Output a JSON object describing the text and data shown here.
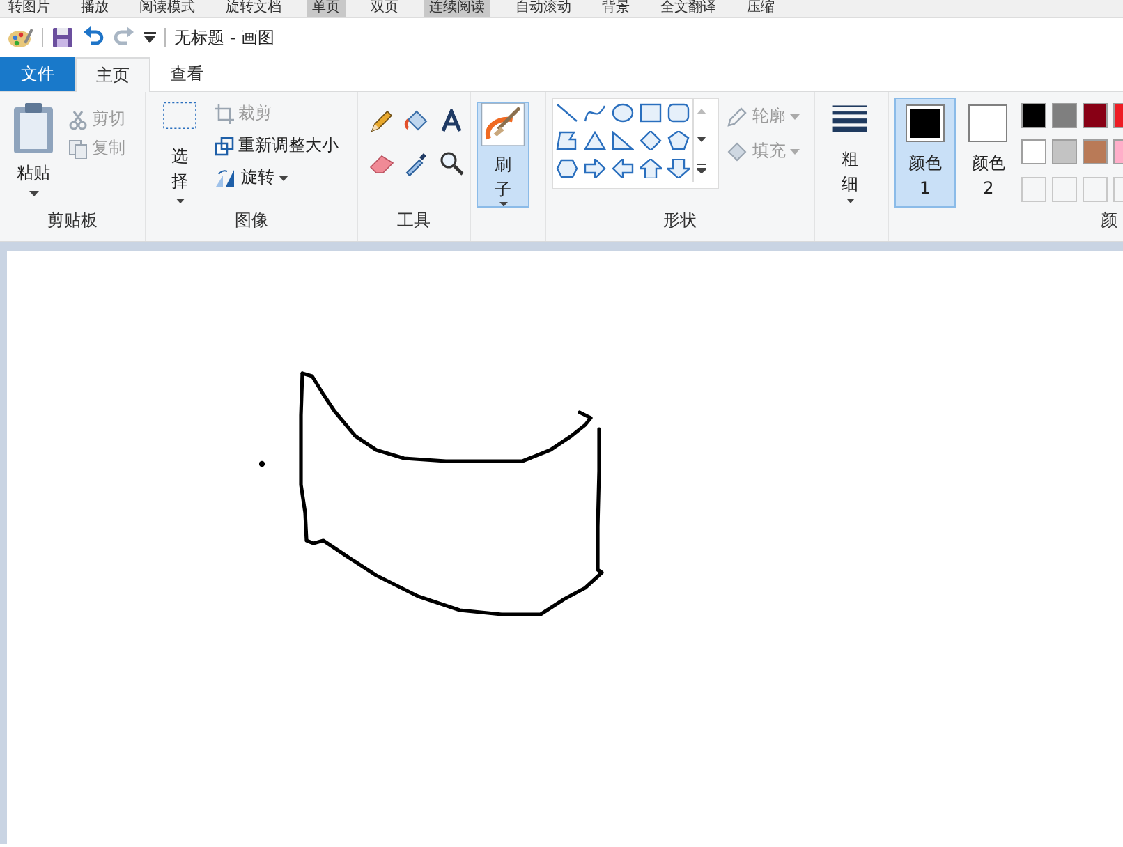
{
  "browser_toolbar": [
    {
      "label": "转图片",
      "selected": false
    },
    {
      "label": "播放",
      "selected": false
    },
    {
      "label": "阅读模式",
      "selected": false
    },
    {
      "label": "旋转文档",
      "selected": false
    },
    {
      "label": "单页",
      "selected": true
    },
    {
      "label": "双页",
      "selected": false
    },
    {
      "label": "连续阅读",
      "selected": true
    },
    {
      "label": "自动滚动",
      "selected": false
    },
    {
      "label": "背景",
      "selected": false
    },
    {
      "label": "全文翻译",
      "selected": false
    },
    {
      "label": "压缩",
      "selected": false
    }
  ],
  "window": {
    "title": "无标题 - 画图"
  },
  "tabs": [
    {
      "label": "文件",
      "kind": "file",
      "selected": false
    },
    {
      "label": "主页",
      "kind": "tab",
      "selected": true
    },
    {
      "label": "查看",
      "kind": "tab",
      "selected": false
    }
  ],
  "ribbon": {
    "clipboard": {
      "paste": "粘贴",
      "cut": {
        "label": "剪切",
        "disabled": true
      },
      "copy": {
        "label": "复制",
        "disabled": true
      },
      "group_label": "剪贴板"
    },
    "image": {
      "select": "选择",
      "crop": {
        "label": "裁剪",
        "disabled": true
      },
      "resize": {
        "label": "重新调整大小",
        "disabled": false
      },
      "rotate": {
        "label": "旋转",
        "disabled": false
      },
      "group_label": "图像"
    },
    "tools": {
      "group_label": "工具"
    },
    "brushes": {
      "label": "刷子",
      "selected": true
    },
    "shapes": {
      "outline": {
        "label": "轮廓",
        "disabled": true
      },
      "fill": {
        "label": "填充",
        "disabled": true
      },
      "group_label": "形状"
    },
    "size": {
      "label": "粗细"
    },
    "colors": {
      "color1": {
        "label": "颜色 1",
        "selected": true,
        "color": "#000000"
      },
      "color2": {
        "label": "颜色 2",
        "selected": false,
        "color": "#ffffff"
      },
      "palette": [
        {
          "color": "#000000"
        },
        {
          "color": "#7f7f7f"
        },
        {
          "color": "#880015"
        },
        {
          "color": "#ed1c24"
        },
        {
          "color": "#ffffff"
        },
        {
          "color": "#c3c3c3"
        },
        {
          "color": "#b97a57"
        },
        {
          "color": "#ffaec9"
        }
      ],
      "group_label": "颜"
    }
  }
}
